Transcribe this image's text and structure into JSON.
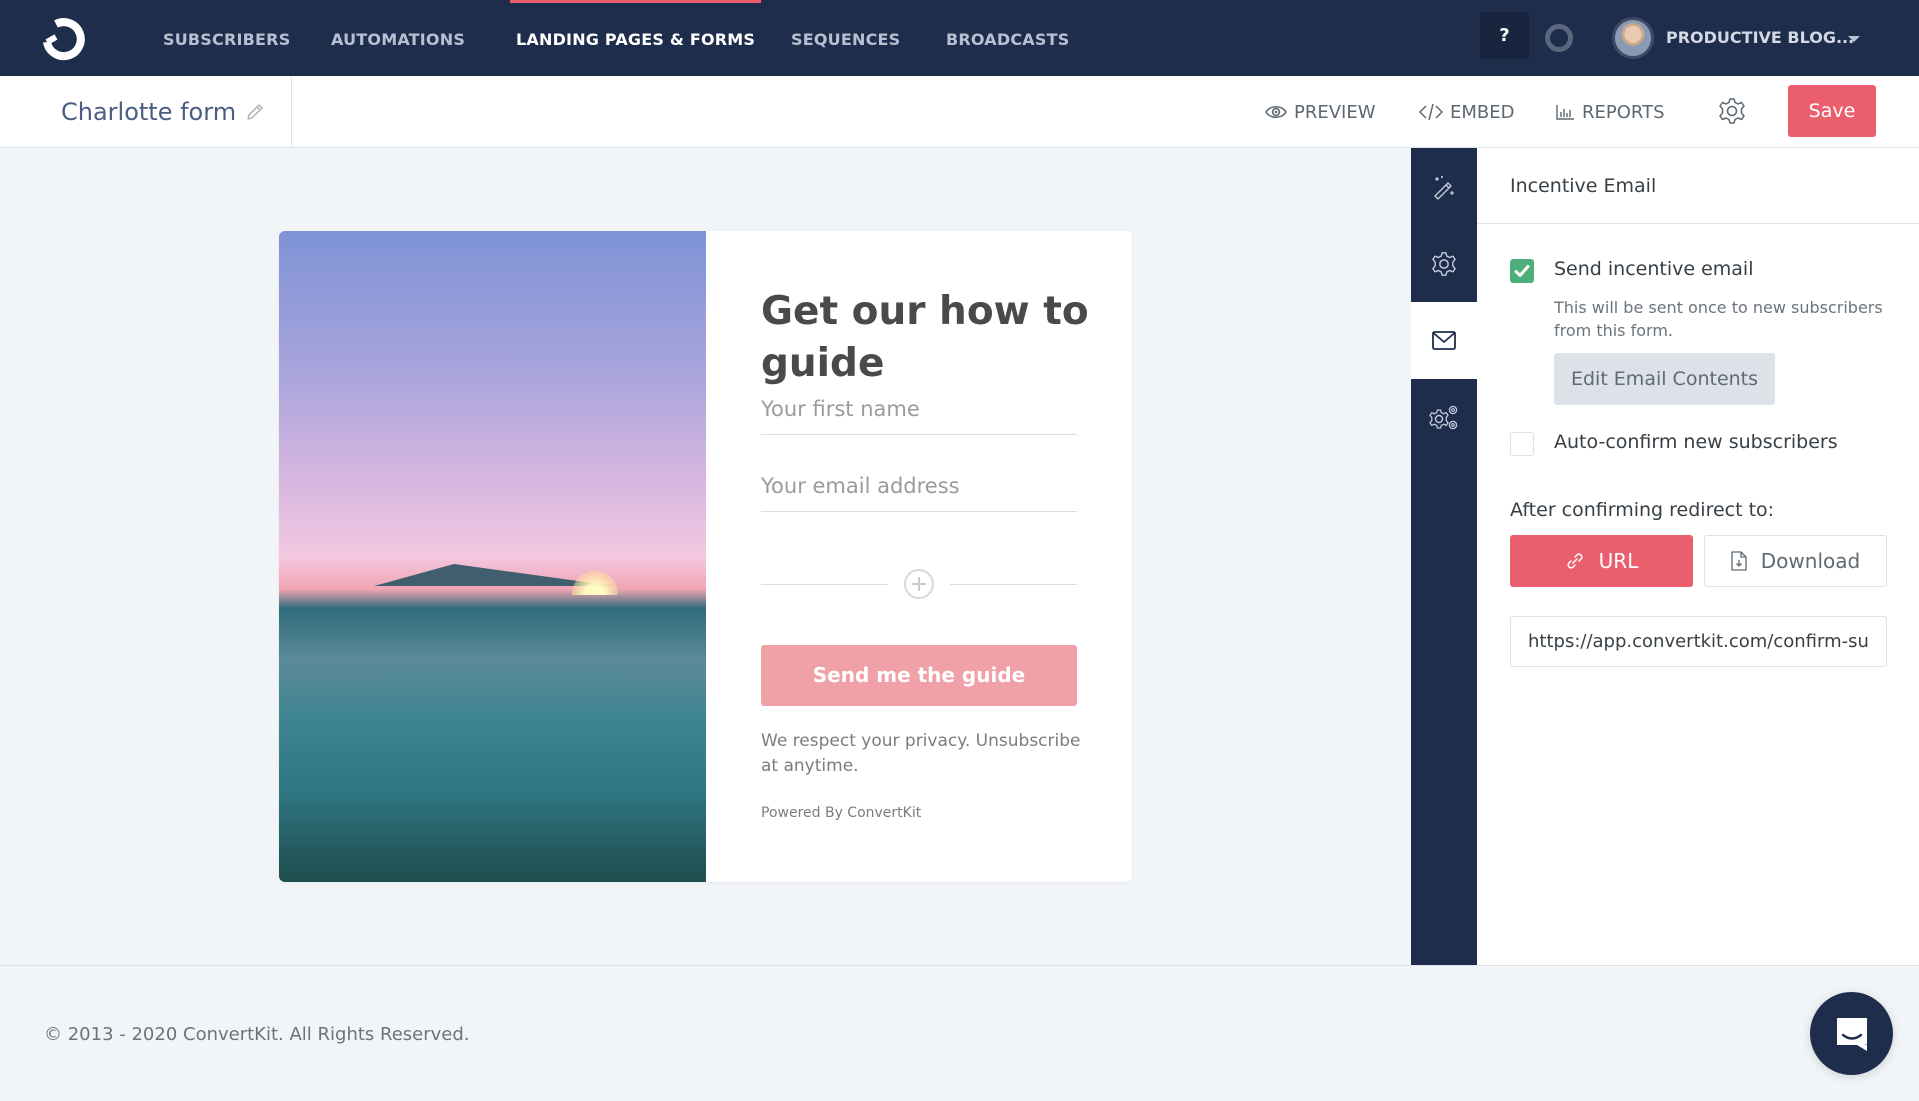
{
  "nav": {
    "items": [
      {
        "label": "SUBSCRIBERS",
        "active": false
      },
      {
        "label": "AUTOMATIONS",
        "active": false
      },
      {
        "label": "LANDING PAGES & FORMS",
        "active": true
      },
      {
        "label": "SEQUENCES",
        "active": false
      },
      {
        "label": "BROADCASTS",
        "active": false
      }
    ],
    "help_label": "?",
    "account_name": "PRODUCTIVE BLOG..."
  },
  "toolbar": {
    "form_title": "Charlotte form",
    "preview_label": "PREVIEW",
    "embed_label": "EMBED",
    "reports_label": "REPORTS",
    "save_label": "Save"
  },
  "form": {
    "heading": "Get our how to guide",
    "first_name_placeholder": "Your first name",
    "email_placeholder": "Your email address",
    "submit_label": "Send me the guide",
    "privacy_text": "We respect your privacy. Unsubscribe at anytime.",
    "powered_by": "Powered By ConvertKit"
  },
  "panel": {
    "tabs": [
      {
        "icon": "magic-wand-icon",
        "active": false
      },
      {
        "icon": "gear-icon",
        "active": false
      },
      {
        "icon": "envelope-icon",
        "active": true
      },
      {
        "icon": "gears-icon",
        "active": false
      }
    ],
    "title": "Incentive Email",
    "send_incentive": {
      "label": "Send incentive email",
      "checked": true
    },
    "help_text": "This will be sent once to new subscribers from this form.",
    "edit_button": "Edit Email Contents",
    "auto_confirm": {
      "label": "Auto-confirm new subscribers",
      "checked": false
    },
    "redirect_label": "After confirming redirect to:",
    "redirect_options": [
      {
        "label": "URL",
        "selected": true
      },
      {
        "label": "Download",
        "selected": false
      }
    ],
    "redirect_url": "https://app.convertkit.com/confirm-su"
  },
  "footer": {
    "copyright": "© 2013 - 2020 ConvertKit. All Rights Reserved."
  },
  "colors": {
    "nav_bg": "#1f2d4d",
    "accent": "#ea5e6e",
    "submit_button": "#f0a1a7",
    "checkbox_on": "#4faf7b"
  }
}
